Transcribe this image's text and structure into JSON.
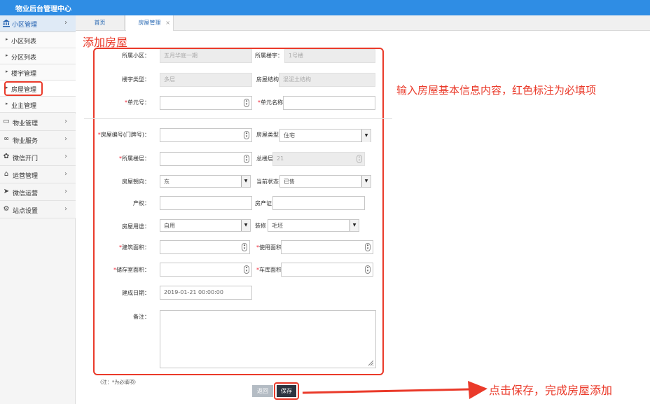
{
  "app": {
    "title": "物业后台管理中心"
  },
  "sidebar": {
    "group_head": {
      "label": "小区管理",
      "icon": "bank-icon"
    },
    "sub_items": [
      {
        "label": "小区列表"
      },
      {
        "label": "分区列表"
      },
      {
        "label": "楼宇管理"
      },
      {
        "label": "房屋管理",
        "active": true
      },
      {
        "label": "业主管理"
      }
    ],
    "groups": [
      {
        "label": "物业管理",
        "icon": "card-icon"
      },
      {
        "label": "物业服务",
        "icon": "link-icon"
      },
      {
        "label": "微信开门",
        "icon": "settings-icon"
      },
      {
        "label": "运营管理",
        "icon": "building-icon"
      },
      {
        "label": "微信运营",
        "icon": "send-icon"
      },
      {
        "label": "站点设置",
        "icon": "gears-icon"
      }
    ]
  },
  "tabs": {
    "home": "首页",
    "current": "房屋管理",
    "close": "×"
  },
  "annotations": {
    "title": "添加房屋",
    "side": "输入房屋基本信息内容，红色标注为必填项",
    "bottom": "点击保存，完成房屋添加",
    "color": "#ea3a2a"
  },
  "form": {
    "community": {
      "label": "所属小区：",
      "value": "五月华庭一期"
    },
    "building": {
      "label": "所属楼宇：",
      "value": "1号楼"
    },
    "building_type": {
      "label": "楼宇类型：",
      "value": "多层"
    },
    "structure": {
      "label": "房屋结构",
      "value": "混泥土结构"
    },
    "unit_no": {
      "star": "*",
      "label": "单元号：",
      "value": ""
    },
    "unit_name": {
      "star": "*",
      "label": "单元名称",
      "value": ""
    },
    "house_no": {
      "star": "*",
      "label": "房屋编号(门牌号)：",
      "value": ""
    },
    "house_type": {
      "label": "房屋类型",
      "value": "住宅"
    },
    "floor": {
      "star": "*",
      "label": "所属楼层：",
      "value": ""
    },
    "total_floors": {
      "label": "总楼层",
      "value": "21"
    },
    "orientation": {
      "label": "房屋朝向：",
      "value": "东"
    },
    "status": {
      "label": "当前状态",
      "value": "已售"
    },
    "property_right": {
      "label": "产权：",
      "value": ""
    },
    "certificate": {
      "label": "房产证",
      "value": ""
    },
    "usage": {
      "label": "房屋用途：",
      "value": "自用"
    },
    "decoration": {
      "label": "装修",
      "value": "毛坯"
    },
    "build_area": {
      "star": "*",
      "label": "建筑面积：",
      "value": ""
    },
    "use_area": {
      "star": "*",
      "label": "使用面积",
      "value": ""
    },
    "storage_area": {
      "star": "*",
      "label": "储存室面积：",
      "value": ""
    },
    "garage_area": {
      "star": "*",
      "label": "车库面积",
      "value": ""
    },
    "build_date": {
      "label": "建成日期：",
      "value": "2019-01-21 00:00:00"
    },
    "remark": {
      "label": "备注：",
      "value": ""
    },
    "note": "(注：*为必填项)",
    "back_label": "返回",
    "save_label": "保存"
  }
}
